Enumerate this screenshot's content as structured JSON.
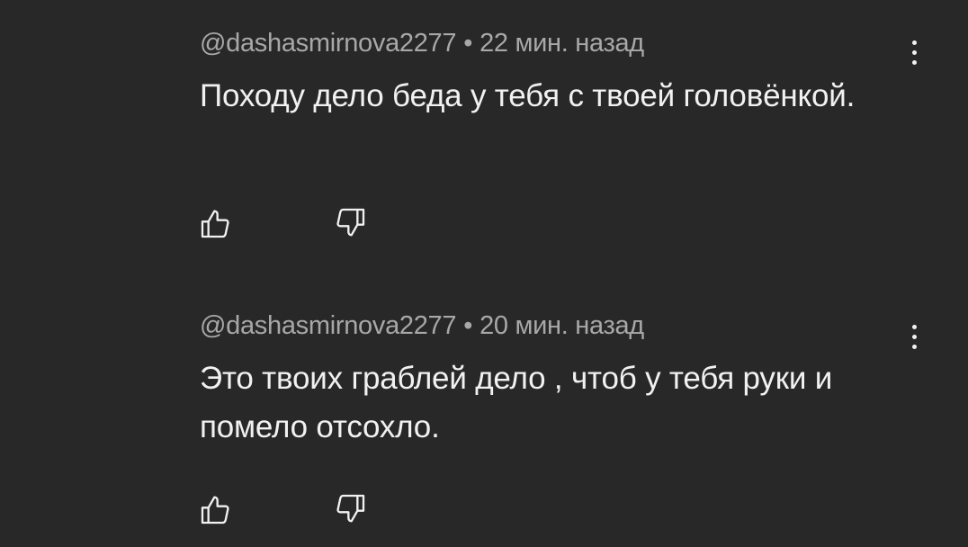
{
  "comments": [
    {
      "author": "@dashasmirnova2277",
      "separator": "•",
      "time": "22 мин. назад",
      "text": "Походу дело беда у тебя с твоей головёнкой.",
      "like_icon": "thumbs-up-icon",
      "dislike_icon": "thumbs-down-icon",
      "menu_icon": "more-vertical-icon"
    },
    {
      "author": "@dashasmirnova2277",
      "separator": "•",
      "time": "20 мин. назад",
      "text": "Это твоих граблей дело , чтоб у тебя руки и помело отсохло.",
      "like_icon": "thumbs-up-icon",
      "dislike_icon": "thumbs-down-icon",
      "menu_icon": "more-vertical-icon"
    }
  ],
  "colors": {
    "background": "#282828",
    "text": "#f1f1f1",
    "meta": "#a8a8a8"
  }
}
